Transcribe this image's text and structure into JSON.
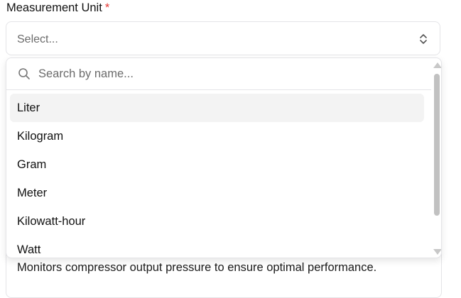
{
  "field": {
    "label": "Measurement Unit",
    "required_marker": "*"
  },
  "select": {
    "placeholder": "Select..."
  },
  "dropdown": {
    "search_placeholder": "Search by name...",
    "highlighted_index": 0,
    "options": [
      {
        "label": "Liter"
      },
      {
        "label": "Kilogram"
      },
      {
        "label": "Gram"
      },
      {
        "label": "Meter"
      },
      {
        "label": "Kilowatt-hour"
      },
      {
        "label": "Watt"
      }
    ]
  },
  "description": {
    "text": "Monitors compressor output pressure to ensure optimal performance."
  },
  "colors": {
    "required": "#e53935",
    "border": "#e4e4e7",
    "highlight": "#f3f3f3",
    "placeholder": "#6b6b6b"
  },
  "icons": {
    "search": "search-icon",
    "chevrons": "chevron-up-down-icon"
  }
}
